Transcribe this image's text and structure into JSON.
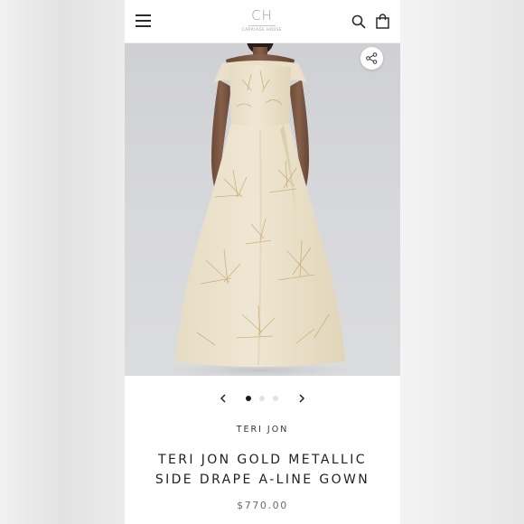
{
  "header": {
    "logo_mark": "CH",
    "logo_subtitle": "CARRIAGE HOUSE",
    "icons": {
      "menu": "hamburger-menu-icon",
      "search": "search-icon",
      "cart": "shopping-bag-icon",
      "share": "share-icon"
    }
  },
  "product": {
    "brand": "TERI JON",
    "title_line1": "TERI JON GOLD METALLIC",
    "title_line2": "SIDE DRAPE A-LINE GOWN",
    "price": "$770.00",
    "gallery": {
      "image_count": 3,
      "active_index": 0
    }
  },
  "colors": {
    "accent_dark": "#1b1b1b",
    "gown": "#ece3cd",
    "gold_pattern": "#c7aa6f",
    "photo_bg": "#d4d5d8"
  }
}
